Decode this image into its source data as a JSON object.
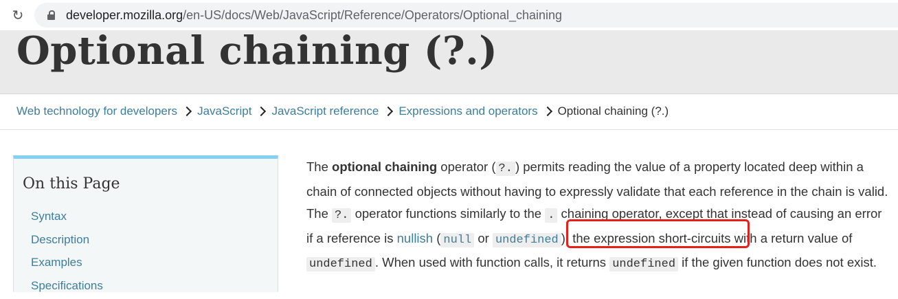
{
  "browser": {
    "reload_icon": "reload-icon",
    "lock_icon": "lock-icon",
    "url_domain": "developer.mozilla.org",
    "url_path": "/en-US/docs/Web/JavaScript/Reference/Operators/Optional_chaining"
  },
  "page": {
    "title": "Optional chaining (?.)"
  },
  "breadcrumb": {
    "items": [
      "Web technology for developers",
      "JavaScript",
      "JavaScript reference",
      "Expressions and operators"
    ],
    "current": "Optional chaining (?.)",
    "separator_icon": "chevron-right-icon"
  },
  "toc": {
    "title": "On this Page",
    "items": [
      "Syntax",
      "Description",
      "Examples",
      "Specifications"
    ]
  },
  "article": {
    "t1": "The ",
    "bold": "optional chaining",
    "t2": " operator (",
    "code_op": "?.",
    "t3": ") permits reading the value of a property located deep within a chain of connected objects without having to expressly validate that each reference in the chain is valid. The ",
    "code_op2": "?.",
    "t4": " operator functions similarly to the ",
    "code_dot": ".",
    "t5": " chaining operator, except that instead of causing an error if a reference is ",
    "link_nullish": "nullish",
    "t6": " (",
    "code_null": "null",
    "t7": " or ",
    "code_undefined": "undefined",
    "t8": "), the expression short-circuits with a return value of ",
    "code_undefined2": "undefined",
    "t9": ". When used with function calls, it returns ",
    "code_undefined3": "undefined",
    "t10": " if the given function does not exist."
  },
  "annotation": {
    "highlight_color": "#e3201b"
  },
  "colors": {
    "link": "#3d7e9a",
    "toc_accent": "#83d0f2",
    "banner_bg": "#eaeaea"
  }
}
